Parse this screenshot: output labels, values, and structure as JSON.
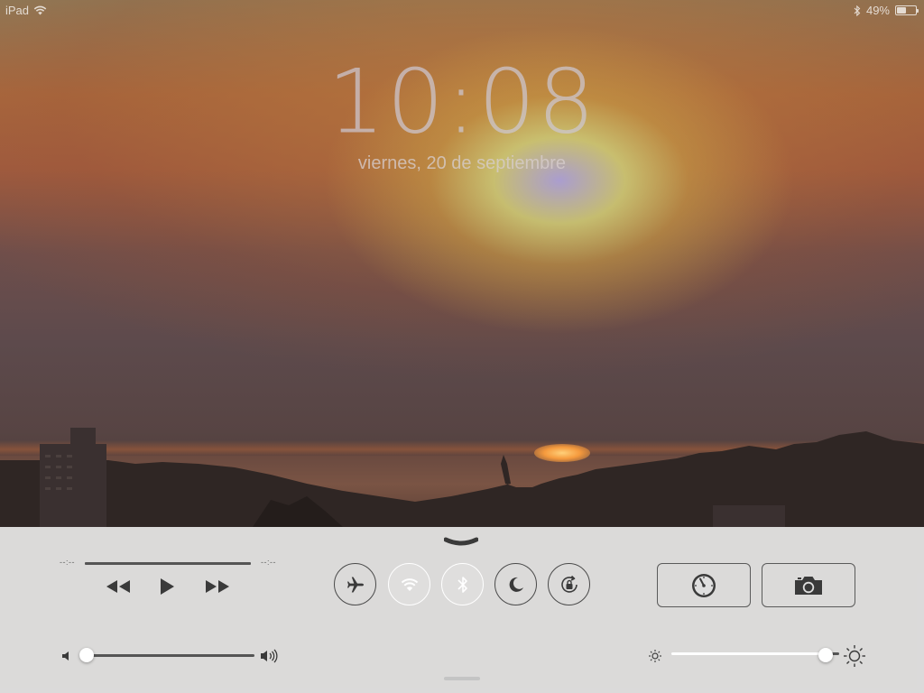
{
  "status_bar": {
    "device_label": "iPad",
    "battery_text": "49%",
    "battery_level": 0.49,
    "icons": [
      "wifi-icon",
      "bluetooth-icon",
      "battery-icon"
    ]
  },
  "lock_screen": {
    "time": "10:08",
    "date": "viernes, 20 de septiembre"
  },
  "control_center": {
    "media": {
      "elapsed": "--:--",
      "remaining": "--:--",
      "controls": [
        "rewind-icon",
        "play-icon",
        "fast-forward-icon"
      ]
    },
    "volume": {
      "level": 0.0
    },
    "toggles": [
      {
        "name": "airplane-mode",
        "icon": "airplane-icon",
        "on": false
      },
      {
        "name": "wifi",
        "icon": "wifi-icon",
        "on": true
      },
      {
        "name": "bluetooth",
        "icon": "bluetooth-icon",
        "on": true
      },
      {
        "name": "do-not-disturb",
        "icon": "moon-icon",
        "on": false
      },
      {
        "name": "rotation-lock",
        "icon": "rotation-lock-icon",
        "on": false
      }
    ],
    "quick_launch": [
      {
        "name": "timer",
        "icon": "timer-icon"
      },
      {
        "name": "camera",
        "icon": "camera-icon"
      }
    ],
    "brightness": {
      "level": 0.92
    }
  },
  "colors": {
    "panel_background": "#dfdfdf",
    "toggle_on_border": "#ffffff",
    "toggle_off_border": "#4a4a4a",
    "icon_dark": "#3a3a3a"
  }
}
